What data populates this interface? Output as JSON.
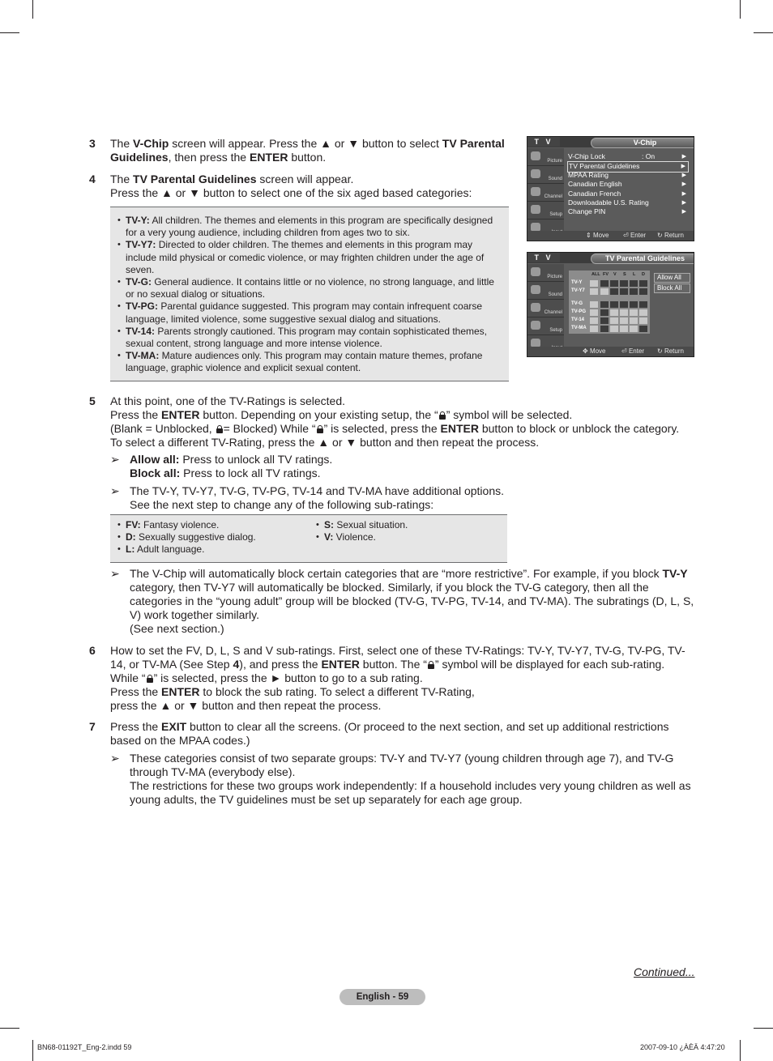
{
  "step3": {
    "number": "3",
    "text_parts": [
      "The ",
      "V-Chip",
      " screen will appear. Press the ▲ or ▼ button to select ",
      "TV Parental Guidelines",
      ", then press the ",
      "ENTER",
      " button."
    ]
  },
  "step4": {
    "number": "4",
    "line1_parts": [
      "The ",
      "TV Parental Guidelines",
      " screen will appear."
    ],
    "line2": "Press the ▲ or ▼ button to select one of the six aged based categories:"
  },
  "ratings": [
    {
      "label": "TV-Y:",
      "desc": "All children. The themes and elements in this program are specifically designed for a very young audience, including children from ages two to six."
    },
    {
      "label": "TV-Y7:",
      "desc": "Directed to older children. The themes and elements in this program may include mild physical or comedic violence, or may frighten children under the age of seven."
    },
    {
      "label": "TV-G:",
      "desc": "General audience. It contains little or no violence, no strong language, and little or no sexual dialog or situations."
    },
    {
      "label": "TV-PG:",
      "desc": "Parental guidance suggested. This program may contain infrequent coarse language, limited violence, some suggestive sexual dialog and situations."
    },
    {
      "label": "TV-14:",
      "desc": "Parents strongly cautioned. This program may contain sophisticated themes, sexual content, strong language and more intense violence."
    },
    {
      "label": "TV-MA:",
      "desc": "Mature audiences only. This program may contain mature themes, profane language, graphic violence and explicit sexual content."
    }
  ],
  "step5": {
    "number": "5",
    "l1": "At this point, one of the TV-Ratings is selected.",
    "l2a": "Press the ",
    "l2b": "ENTER",
    "l2c": " button. Depending on your existing setup, the “",
    "l2d": "” symbol will be selected.",
    "l3a": "(Blank = Unblocked, ",
    "l3b": "= Blocked) While “",
    "l3c": "” is selected, press the ",
    "l3d": "ENTER",
    "l3e": " button to block or unblock the category.",
    "l4": "To select a different TV-Rating, press the ▲ or ▼ button and then repeat the process.",
    "note1": {
      "allow_label": "Allow all:",
      "allow_text": " Press to unlock all TV ratings.",
      "block_label": "Block all:",
      "block_text": " Press to lock all TV ratings."
    },
    "note2": {
      "l1": "The TV-Y, TV-Y7, TV-G, TV-PG, TV-14 and TV-MA have additional options.",
      "l2": "See the next step to change any of the following sub-ratings:"
    },
    "subratings": [
      {
        "label": "FV:",
        "desc": " Fantasy violence."
      },
      {
        "label": "D:",
        "desc": " Sexually suggestive dialog."
      },
      {
        "label": "L:",
        "desc": " Adult language."
      },
      {
        "label": "S:",
        "desc": " Sexual situation."
      },
      {
        "label": "V:",
        "desc": " Violence."
      }
    ],
    "note3": {
      "a": "The V-Chip will automatically block certain categories that are “more restrictive”. For example, if you block ",
      "b": "TV-Y",
      "c": " category, then TV-Y7 will automatically be blocked. Similarly, if you block the TV-G category, then all the categories in the “young adult” group will be blocked (TV-G, TV-PG, TV-14, and TV-MA). The subratings (D, L, S, V) work together similarly.",
      "d": "(See next section.)"
    }
  },
  "step6": {
    "number": "6",
    "a": "How to set the FV, D, L, S and V sub-ratings. First, select one of these TV-Ratings: TV-Y, TV-Y7, TV-G, TV-PG, TV-14, or TV-MA (See Step ",
    "b": "4",
    "c": "), and press the ",
    "d": "ENTER",
    "e": " button. The “",
    "f": "” symbol will be displayed for each sub-rating. While “",
    "g": "” is selected, press the ► button to go to a sub rating.",
    "h": "Press the ",
    "i": "ENTER",
    "j": " to block the sub rating. To select a different TV-Rating,",
    "k": "press the ▲ or ▼ button and then repeat the process."
  },
  "step7": {
    "number": "7",
    "a": "Press the ",
    "b": "EXIT",
    "c": " button to clear all the screens. (Or proceed to the next section, and set up additional restrictions based on the MPAA codes.)",
    "note_l1": "These categories consist of two separate groups: TV-Y and TV-Y7 (young children through age 7), and TV-G through TV-MA (everybody else).",
    "note_l2": "The restrictions for these two groups work independently: If a household includes very young children as well as young adults, the TV guidelines must be set up separately for each age group."
  },
  "note_arrow": "➢",
  "screen1": {
    "tv_label": "T V",
    "title": "V-Chip",
    "sidebar": [
      "Picture",
      "Sound",
      "Channel",
      "Setup",
      "Input"
    ],
    "menu": [
      {
        "label": "V-Chip Lock",
        "value": ": On",
        "arrow": "▶"
      },
      {
        "label": "TV Parental Guidelines",
        "value": "",
        "arrow": "▶",
        "selected": true
      },
      {
        "label": "MPAA Rating",
        "value": "",
        "arrow": "▶"
      },
      {
        "label": "Canadian English",
        "value": "",
        "arrow": "▶"
      },
      {
        "label": "Canadian French",
        "value": "",
        "arrow": "▶"
      },
      {
        "label": "Downloadable U.S. Rating",
        "value": "",
        "arrow": "▶"
      },
      {
        "label": "Change PIN",
        "value": "",
        "arrow": "▶"
      }
    ],
    "footer": {
      "move": "Move",
      "enter": "Enter",
      "return": "Return"
    }
  },
  "screen2": {
    "tv_label": "T V",
    "title": "TV Parental Guidelines",
    "sidebar": [
      "Picture",
      "Sound",
      "Channel",
      "Setup",
      "Input"
    ],
    "columns": [
      "ALL",
      "FV",
      "V",
      "S",
      "L",
      "D"
    ],
    "rows": [
      "TV-Y",
      "TV-Y7",
      "TV-G",
      "TV-PG",
      "TV-14",
      "TV-MA"
    ],
    "buttons": [
      "Allow All",
      "Block All"
    ],
    "footer": {
      "move": "Move",
      "enter": "Enter",
      "return": "Return"
    }
  },
  "continued": "Continued...",
  "page_label": "English - 59",
  "footer_left": "BN68-01192T_Eng-2.indd   59",
  "footer_right": "2007-09-10   ¿ÀÈÄ 4:47:20"
}
